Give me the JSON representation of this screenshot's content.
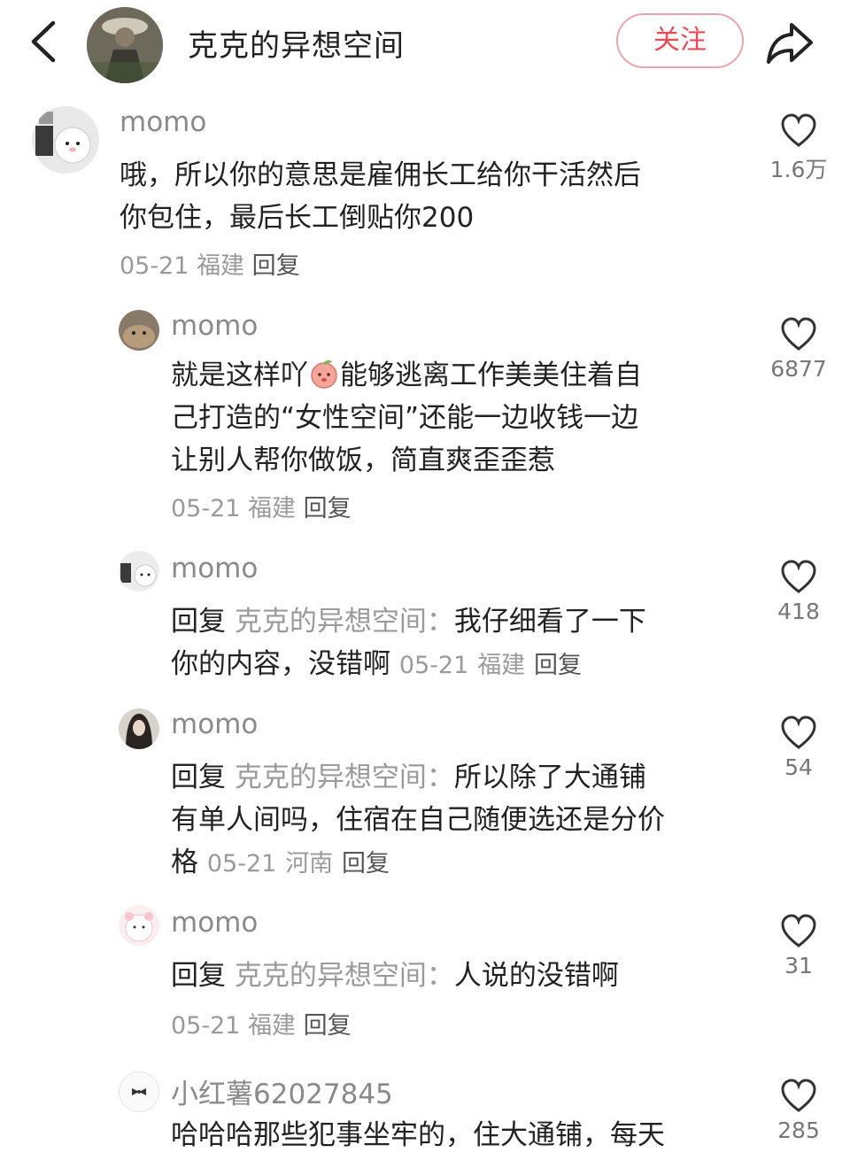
{
  "header": {
    "title": "克克的异想空间",
    "follow_label": "关注"
  },
  "comments": [
    {
      "name": "momo",
      "text_lines": [
        "哦，所以你的意思是雇佣长工给你干活然后",
        "你包住，最后长工倒贴你200"
      ],
      "date": "05-21",
      "location": "福建",
      "reply_label": "回复",
      "likes": "1.6万"
    },
    {
      "name": "momo",
      "text_line1_before": "就是这样吖",
      "text_line1_after": "能够逃离工作美美住着自",
      "text_lines": [
        "己打造的“女性空间”还能一边收钱一边",
        "让别人帮你做饭，简直爽歪歪惹"
      ],
      "date": "05-21",
      "location": "福建",
      "reply_label": "回复",
      "likes": "6877"
    },
    {
      "name": "momo",
      "reply_prefix": "回复",
      "reply_target": "克克的异想空间：",
      "text_line1": "我仔细看了一下",
      "text_line2": "你的内容，没错啊",
      "date": "05-21",
      "location": "福建",
      "reply_label": "回复",
      "likes": "418"
    },
    {
      "name": "momo",
      "reply_prefix": "回复",
      "reply_target": "克克的异想空间：",
      "text_line1": "所以除了大通铺",
      "text_line2": "有单人间吗，住宿在自己随便选还是分价",
      "text_line3": "格",
      "date": "05-21",
      "location": "河南",
      "reply_label": "回复",
      "likes": "54"
    },
    {
      "name": "momo",
      "reply_prefix": "回复",
      "reply_target": "克克的异想空间：",
      "text_line1": "人说的没错啊",
      "date": "05-21",
      "location": "福建",
      "reply_label": "回复",
      "likes": "31"
    },
    {
      "name": "小红薯62027845",
      "text_line1": "哈哈哈那些犯事坐牢的，住大通铺，每天",
      "likes": "285"
    }
  ]
}
